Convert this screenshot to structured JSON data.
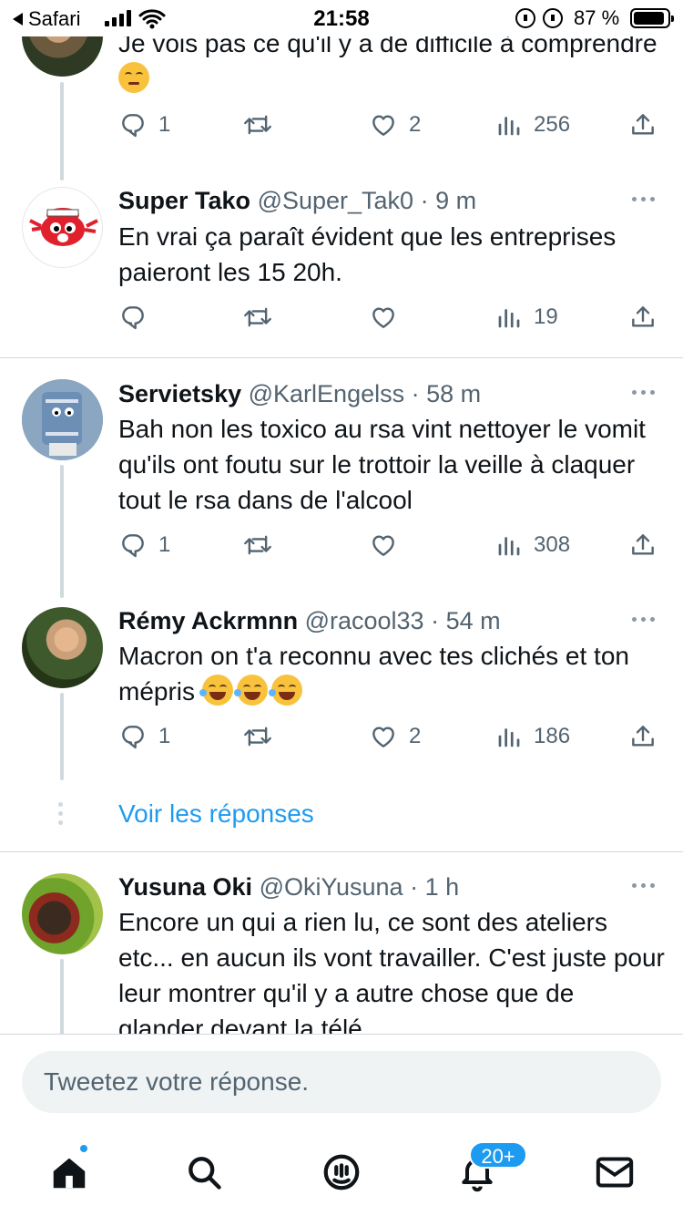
{
  "status_bar": {
    "back_app": "Safari",
    "time": "21:58",
    "battery": "87 %"
  },
  "tweets": [
    {
      "name": "",
      "handle": "",
      "time": "",
      "text": "Je vois pas ce qu'il y a de difficile à comprendre",
      "emoji": "thinking-face",
      "replies": "1",
      "retweets": "",
      "likes": "2",
      "views": "256"
    },
    {
      "name": "Super Tako",
      "handle": "@Super_Tak0",
      "time": "· 9 m",
      "text": "En vrai ça paraît évident que les entreprises paieront les 15 20h.",
      "replies": "",
      "retweets": "",
      "likes": "",
      "views": "19"
    },
    {
      "name": "Servietsky",
      "handle": "@KarlEngelss",
      "time": "· 58 m",
      "text": "Bah non les toxico au rsa vint nettoyer le vomit qu'ils ont foutu sur le trottoir la veille à claquer tout le rsa dans de l'alcool",
      "replies": "1",
      "retweets": "",
      "likes": "",
      "views": "308"
    },
    {
      "name": "Rémy Ackrmnn",
      "handle": "@racool33",
      "time": "· 54 m",
      "text": "Macron on t'a reconnu avec tes clichés et ton mépris",
      "emoji": "laughing-face ×3",
      "replies": "1",
      "retweets": "",
      "likes": "2",
      "views": "186"
    },
    {
      "name": "Yusuna Oki",
      "handle": "@OkiYusuna",
      "time": "· 1 h",
      "text": "Encore un qui a rien lu, ce sont des ateliers etc... en aucun ils vont travailler. C'est juste pour leur montrer qu'il y a autre chose que de glander devant la télé"
    }
  ],
  "show_replies_label": "Voir les réponses",
  "composer": {
    "placeholder": "Tweetez votre réponse."
  },
  "tabbar": {
    "notifications_badge": "20+"
  },
  "colors": {
    "accent": "#1d9bf0",
    "text": "#0f1419",
    "secondary": "#536471",
    "border": "#cfd9de"
  }
}
